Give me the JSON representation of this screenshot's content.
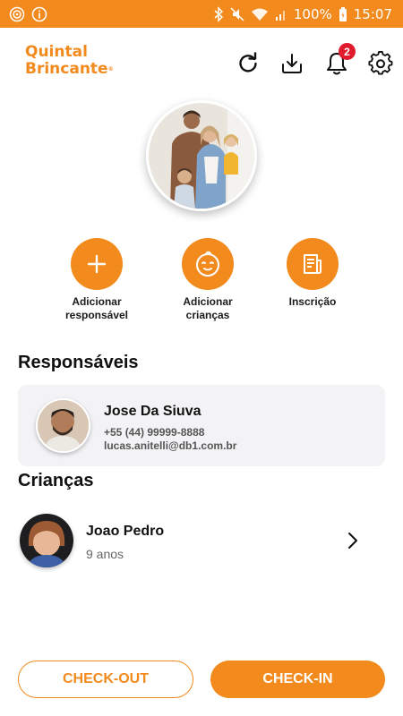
{
  "status_bar": {
    "battery": "100%",
    "time": "15:07"
  },
  "header": {
    "logo_line1": "Quintal",
    "logo_line2": "Brincante",
    "logo_reg": "®",
    "notification_count": "2"
  },
  "actions": [
    {
      "label": "Adicionar\nresponsável",
      "icon": "plus-icon"
    },
    {
      "label": "Adicionar\ncrianças",
      "icon": "baby-face-icon"
    },
    {
      "label": "Inscrição",
      "icon": "document-icon"
    }
  ],
  "guardians_section": {
    "title": "Responsáveis",
    "items": [
      {
        "name": "Jose Da Siuva",
        "phone": "+55 (44) 99999-8888",
        "email": "lucas.anitelli@db1.com.br"
      }
    ]
  },
  "children_section": {
    "title": "Crianças",
    "items": [
      {
        "name": "Joao Pedro",
        "age": "9 anos"
      }
    ]
  },
  "buttons": {
    "checkout": "CHECK-OUT",
    "checkin": "CHECK-IN"
  },
  "colors": {
    "accent": "#f28a1d",
    "badge": "#e01b2d"
  }
}
